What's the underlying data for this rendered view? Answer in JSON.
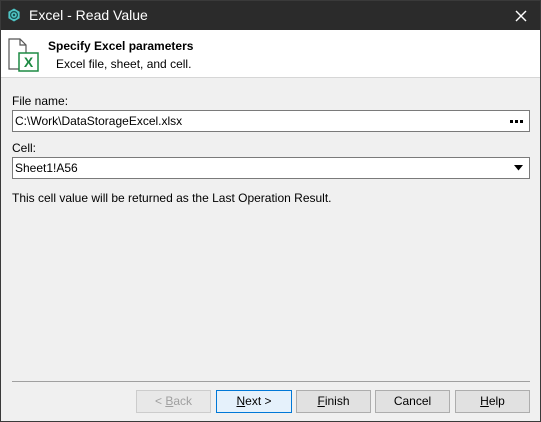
{
  "window": {
    "title": "Excel - Read Value",
    "app_icon": "gear-globe-icon",
    "close_icon": "close-icon"
  },
  "header": {
    "title": "Specify Excel parameters",
    "subtitle": "Excel file, sheet, and cell.",
    "icon": "excel-file-icon"
  },
  "form": {
    "file_label": "File name:",
    "file_value": "C:\\Work\\DataStorageExcel.xlsx",
    "browse_icon": "ellipsis-icon",
    "cell_label": "Cell:",
    "cell_value": "Sheet1!A56",
    "info": "This cell value will be returned as the Last Operation Result."
  },
  "buttons": {
    "back": {
      "pre": "< ",
      "key": "B",
      "post": "ack"
    },
    "next": {
      "pre": "",
      "key": "N",
      "post": "ext >"
    },
    "finish": {
      "pre": "",
      "key": "F",
      "post": "inish"
    },
    "cancel": "Cancel",
    "help": {
      "pre": "",
      "key": "H",
      "post": "elp"
    }
  },
  "colors": {
    "titlebar": "#2b2b2b",
    "accent": "#0078d7",
    "excel_green": "#1d8a43"
  }
}
